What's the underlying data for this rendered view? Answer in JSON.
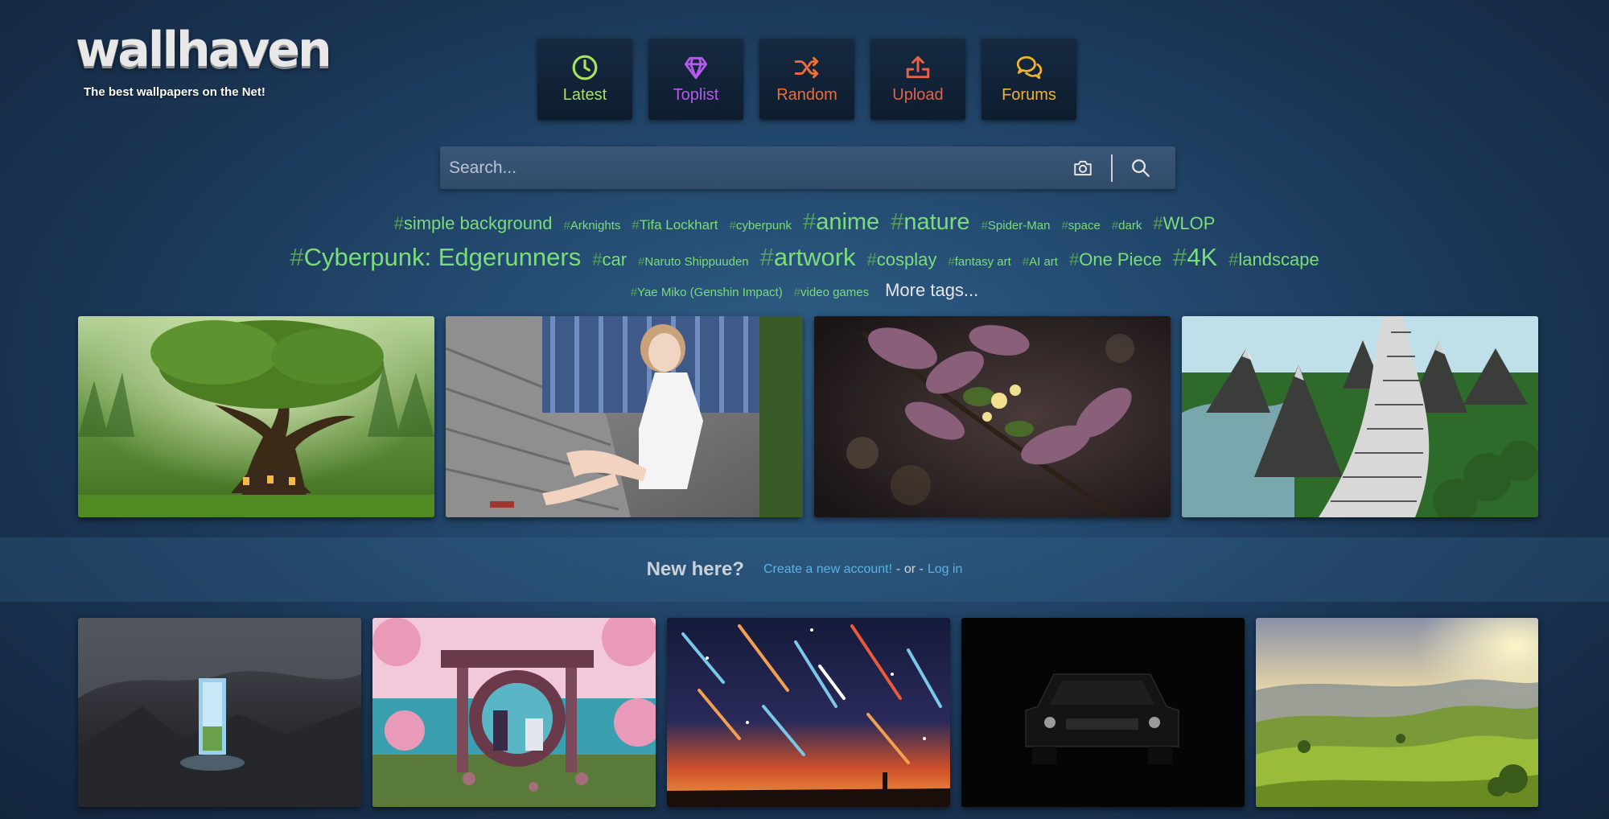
{
  "logo": {
    "name": "wallhaven",
    "tagline": "The best wallpapers on the Net!"
  },
  "nav": {
    "latest": {
      "label": "Latest",
      "icon": "clock-icon",
      "color": "#a8e25c"
    },
    "toplist": {
      "label": "Toplist",
      "icon": "diamond-icon",
      "color": "#b45bec"
    },
    "random": {
      "label": "Random",
      "icon": "shuffle-icon",
      "color": "#ee6d3a"
    },
    "upload": {
      "label": "Upload",
      "icon": "upload-icon",
      "color": "#e86045"
    },
    "forums": {
      "label": "Forums",
      "icon": "chat-bubbles-icon",
      "color": "#efb52a"
    }
  },
  "search": {
    "placeholder": "Search...",
    "camera_icon": "camera-icon",
    "search_icon": "magnifier-icon"
  },
  "tags": {
    "row1": [
      "simple background",
      "Arknights",
      "Tifa Lockhart",
      "cyberpunk",
      "anime",
      "nature",
      "Spider-Man",
      "space",
      "dark",
      "WLOP"
    ],
    "row2": [
      "Cyberpunk: Edgerunners",
      "car",
      "Naruto Shippuuden",
      "artwork",
      "cosplay",
      "fantasy art",
      "AI art",
      "One Piece",
      "4K",
      "landscape"
    ],
    "row3": [
      "Yae Miko (Genshin Impact)",
      "video games"
    ],
    "more": "More tags...",
    "color": "#7adc7a"
  },
  "new_here": {
    "question": "New here?",
    "create_account": "Create a new account!",
    "or": "- or -",
    "login": "Log in"
  },
  "featured_thumbnails": [
    {
      "subject": "giant tree with cottage in green forest"
    },
    {
      "subject": "woman in white dress sitting on bridge"
    },
    {
      "subject": "purple leaves with small flowers"
    },
    {
      "subject": "keyboard road through green mountains"
    }
  ],
  "latest_thumbnails": [
    {
      "subject": "glowing portal door in dark mountains"
    },
    {
      "subject": "anime torii gate with cherry blossoms by sea"
    },
    {
      "subject": "meteor shower over fiery sky"
    },
    {
      "subject": "car headlights in the dark"
    },
    {
      "subject": "green rolling hills at sunrise"
    }
  ]
}
